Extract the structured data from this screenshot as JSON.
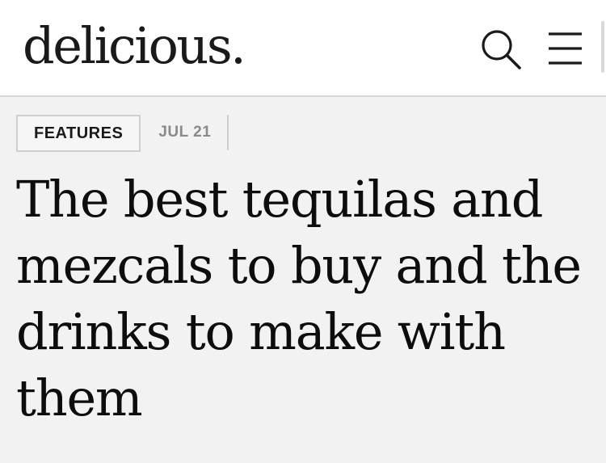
{
  "header": {
    "logo": "delicious.",
    "search_icon": "search-icon",
    "menu_icon": "hamburger-menu-icon"
  },
  "article": {
    "category": "FEATURES",
    "date": "JUL 21",
    "headline": "The best tequilas and mezcals to buy and the drinks to make with them"
  },
  "colors": {
    "header_background": "#ffffff",
    "page_background": "#f2f2f2",
    "text": "#111111",
    "date_text": "#8a8a8a",
    "border": "#cfcfcf"
  }
}
